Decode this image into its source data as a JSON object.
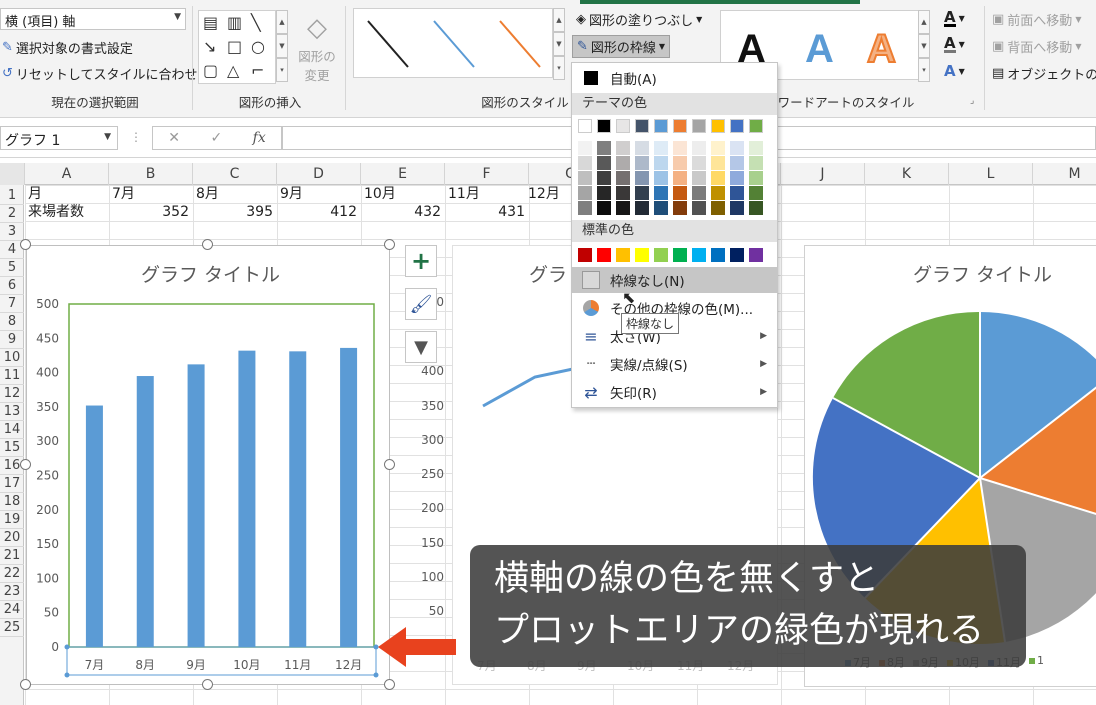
{
  "ribbon": {
    "selection_combo": "横 (項目) 軸",
    "format_selection": "選択対象の書式設定",
    "reset_style": "リセットしてスタイルに合わせる",
    "group_current": "現在の選択範囲",
    "group_insert": "図形の挿入",
    "change_shape": "図形の\n変更",
    "group_styles": "図形のスタイル",
    "fill_button": "図形の塗りつぶし",
    "outline_button": "図形の枠線",
    "group_wordart": "ワードアートのスタイル",
    "wordart_letter": "A",
    "bring_forward": "前面へ移動",
    "send_backward": "背面へ移動",
    "selection_pane": "オブジェクトの選"
  },
  "formula_bar": {
    "name_box": "グラフ 1",
    "fx": "fx"
  },
  "columns": [
    "A",
    "B",
    "C",
    "D",
    "E",
    "F",
    "G",
    "H",
    "I",
    "J",
    "K",
    "L",
    "M"
  ],
  "rows": [
    "1",
    "2",
    "3",
    "4",
    "5",
    "6",
    "7",
    "8",
    "9",
    "10",
    "11",
    "12",
    "13",
    "14",
    "15",
    "16",
    "17",
    "18",
    "19",
    "20",
    "21",
    "22",
    "23",
    "24",
    "25"
  ],
  "sheet": {
    "row1": [
      "月",
      "7月",
      "8月",
      "9月",
      "10月",
      "11月",
      "12月"
    ],
    "row2_label": "来場者数",
    "row2_values": [
      "352",
      "395",
      "412",
      "432",
      "431"
    ]
  },
  "charts": {
    "bar_title": "グラフ タイトル",
    "line_title": "グラ",
    "pie_title": "グラフ タイトル",
    "line_yticks": [
      "0",
      "400",
      "350",
      "300",
      "250",
      "200",
      "150",
      "100",
      "50"
    ],
    "line_xticks": [
      "7月",
      "8月",
      "9月",
      "10月",
      "11月",
      "12月"
    ],
    "pie_legend": [
      "7月",
      "8月",
      "9月",
      "10月",
      "11月",
      "1"
    ]
  },
  "chart_data": {
    "type": "bar",
    "title": "グラフ タイトル",
    "categories": [
      "7月",
      "8月",
      "9月",
      "10月",
      "11月",
      "12月"
    ],
    "values": [
      352,
      395,
      412,
      432,
      431,
      436
    ],
    "yticks": [
      "0",
      "50",
      "100",
      "150",
      "200",
      "250",
      "300",
      "350",
      "400",
      "450",
      "500"
    ],
    "ylim": [
      0,
      500
    ],
    "xlabel": "",
    "ylabel": "",
    "color": "#5b9bd5",
    "plot_area_border": "#70ad47"
  },
  "menu": {
    "auto": "自動(A)",
    "theme_colors": "テーマの色",
    "standard_colors": "標準の色",
    "no_outline": "枠線なし(N)",
    "more_colors": "その他の枠線の色(M)...",
    "weight": "太さ(W)",
    "dashes": "実線/点線(S)",
    "arrows": "矢印(R)",
    "tooltip": "枠線なし",
    "theme_top": [
      "#ffffff",
      "#000000",
      "#e7e6e6",
      "#44546a",
      "#5b9bd5",
      "#ed7d31",
      "#a5a5a5",
      "#ffc000",
      "#4472c4",
      "#70ad47"
    ],
    "standard": [
      "#c00000",
      "#ff0000",
      "#ffc000",
      "#ffff00",
      "#92d050",
      "#00b050",
      "#00b0f0",
      "#0070c0",
      "#002060",
      "#7030a0"
    ]
  },
  "caption": {
    "line1": "横軸の線の色を無くすと",
    "line2": "プロットエリアの緑色が現れる"
  }
}
